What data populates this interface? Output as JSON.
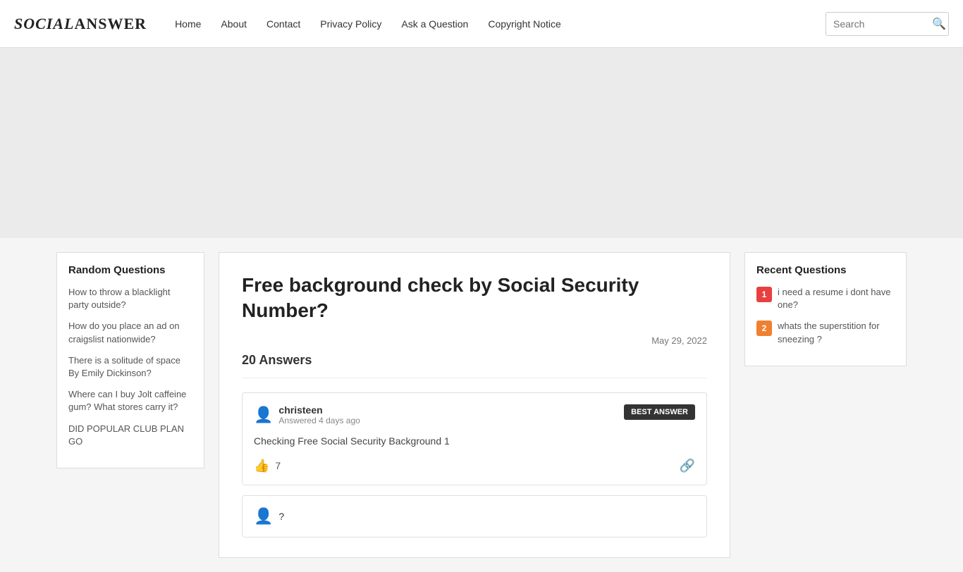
{
  "header": {
    "logo_social": "Social",
    "logo_answer": "Answer",
    "nav": {
      "home": "Home",
      "about": "About",
      "contact": "Contact",
      "privacy_policy": "Privacy Policy",
      "ask_question": "Ask a Question",
      "copyright_notice": "Copyright Notice"
    },
    "search_placeholder": "Search",
    "search_icon": "🔍"
  },
  "sidebar": {
    "title": "Random Questions",
    "links": [
      "How to throw a blacklight party outside?",
      "How do you place an ad on craigslist nationwide?",
      "There is a solitude of space By Emily Dickinson?",
      "Where can I buy Jolt caffeine gum? What stores carry it?",
      "DID POPULAR CLUB PLAN GO"
    ]
  },
  "content": {
    "question_title": "Free background check by Social Security Number?",
    "question_date": "May 29, 2022",
    "answers_label": "20 Answers",
    "best_answer": {
      "username": "christeen",
      "answered_time": "Answered 4 days ago",
      "badge": "BEST ANSWER",
      "body": "Checking Free Social Security Background 1",
      "likes": "7",
      "user_icon": "👤",
      "link_icon": "🔗"
    },
    "second_answer": {
      "username": "?",
      "user_icon": "👤"
    }
  },
  "right_sidebar": {
    "title": "Recent Questions",
    "items": [
      {
        "number": "1",
        "color_class": "num-red",
        "text": "i need a resume i dont have one?"
      },
      {
        "number": "2",
        "color_class": "num-orange",
        "text": "whats the superstition for sneezing ?"
      }
    ]
  }
}
